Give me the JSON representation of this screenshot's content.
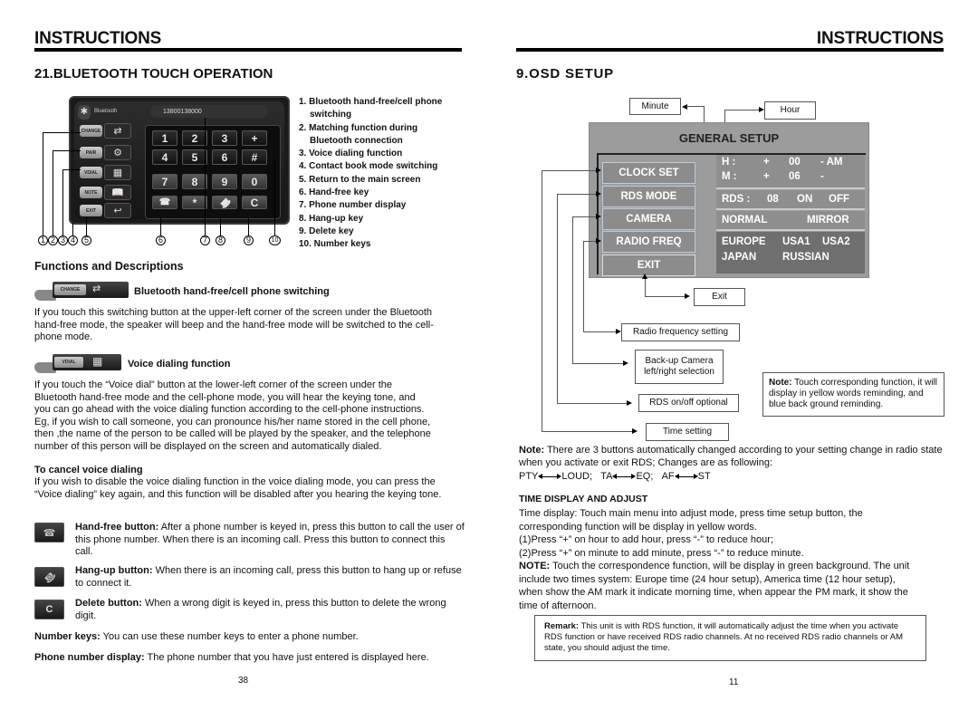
{
  "left_page": {
    "header": "INSTRUCTIONS",
    "section_title": "21.BLUETOOTH TOUCH OPERATION",
    "device_screen": {
      "brand_label": "Bluetooth",
      "phone_number": "13800138000",
      "side_buttons": [
        "CHANGE",
        "PAIR",
        "VDIAL",
        "NOTE",
        "EXIT"
      ],
      "keys": [
        "1",
        "2",
        "3",
        "+",
        "4",
        "5",
        "6",
        "#",
        "7",
        "8",
        "9",
        "0",
        "call",
        "*",
        "hangup",
        "C"
      ],
      "callouts": [
        "1",
        "2",
        "3",
        "4",
        "5",
        "6",
        "7",
        "8",
        "9",
        "10"
      ]
    },
    "legend": [
      "1. Bluetooth hand-free/cell phone switching",
      "2. Matching function during Bluetooth connection",
      "3. Voice dialing function",
      "4. Contact book mode switching",
      "5. Return to the main screen",
      "6. Hand-free key",
      "7. Phone number display",
      "8. Hang-up key",
      "9. Delete key",
      "10. Number keys"
    ],
    "functions_title": "Functions and Descriptions",
    "switching": {
      "button_label": "CHANGE",
      "title": "Bluetooth hand-free/cell phone switching",
      "text": "If you touch this switching button at the upper-left corner of the screen under the Bluetooth hand-free mode, the speaker will beep and the hand-free mode will be switched to the cell-phone mode."
    },
    "voice": {
      "button_label": "VDIAL",
      "title": "Voice dialing function",
      "text": "If you touch the “Voice dial” button at the lower-left corner of the screen under the Bluetooth hand-free mode and the cell-phone mode, you will hear the keying tone, and you can go ahead with the voice dialing function according to the cell-phone instructions. Eg, if you wish to call someone, you can pronounce his/her name stored in the cell phone, then ,the name of the person to be called will be played by the speaker, and the telephone number of this person will be displayed on the screen and automatically dialed.",
      "cancel_title": "To cancel voice dialing",
      "cancel_text": "If you wish to disable the voice dialing function in the voice dialing mode, you can press the “Voice dialing” key again, and this function will be disabled after you hearing the keying tone."
    },
    "buttons_desc": [
      {
        "icon": "handset-icon",
        "label": "Hand-free button:",
        "text": " After a phone number is keyed in, press this button to call the user of this phone number. When there is an incoming call. Press this button to connect this call."
      },
      {
        "icon": "hangup-icon",
        "label": "Hang-up button:",
        "text": " When there is an incoming call, press this button to hang up or refuse to connect it."
      },
      {
        "icon": "delete-c-icon",
        "glyph": "C",
        "label": "Delete button:",
        "text": " When a wrong digit is keyed in, press this button to delete the wrong digit."
      }
    ],
    "number_keys": {
      "label": "Number keys:",
      "text": " You can use these number keys to enter a phone number."
    },
    "phone_display": {
      "label": "Phone number display:",
      "text": " The phone number that you have just entered is displayed here."
    },
    "page_number": "38"
  },
  "right_page": {
    "header": "INSTRUCTIONS",
    "section_title": "9.OSD SETUP",
    "osd": {
      "title": "GENERAL SETUP",
      "menu": [
        "CLOCK SET",
        "RDS MODE",
        "CAMERA",
        "RADIO FREQ",
        "EXIT"
      ],
      "clock": {
        "h_label": "H :",
        "h_plus": "+",
        "h_value": "00",
        "h_minus": "- AM",
        "m_label": "M :",
        "m_plus": "+",
        "m_value": "06",
        "m_minus": "-"
      },
      "rds": {
        "label": "RDS :",
        "value": "08",
        "on": "ON",
        "off": "OFF"
      },
      "camera": {
        "normal": "NORMAL",
        "mirror": "MIRROR"
      },
      "radio": [
        "EUROPE",
        "USA1",
        "USA2",
        "JAPAN",
        "RUSSIAN"
      ]
    },
    "labels": {
      "minute": "Minute",
      "hour": "Hour",
      "exit": "Exit",
      "radio_freq": "Radio frequency setting",
      "camera": "Back-up Camera left/right selection",
      "rds": "RDS on/off optional",
      "time": "Time setting"
    },
    "note_box": {
      "label": "Note:",
      "text": " Touch corresponding function, it will display in yellow words reminding, and blue back ground reminding."
    },
    "note_rds": {
      "label": "Note:",
      "text": " There are 3 buttons automatically changed according to your setting change in radio state when you activate or exit RDS; Changes are as following:"
    },
    "swaps": [
      {
        "a": "PTY",
        "b": "LOUD;"
      },
      {
        "a": "TA",
        "b": "EQ;"
      },
      {
        "a": "AF",
        "b": "ST"
      }
    ],
    "time_title": "TIME DISPLAY AND ADJUST",
    "time_text": [
      "Time display: Touch main menu into adjust mode, press time setup button, the corresponding function will be display in yellow words.",
      "(1)Press “+” on hour to add hour, press “-” to reduce hour;",
      "(2)Press “+” on minute to add minute, press “-” to reduce minute."
    ],
    "time_note": {
      "label": "NOTE:",
      "text": " Touch the correspondence function, will be display in green background. The unit include two times system: Europe time (24 hour setup), America time (12 hour setup), when show the AM mark it indicate morning time, when appear the PM mark, it show the time of afternoon."
    },
    "remark": {
      "label": "Remark:",
      "text": " This unit is with RDS function, it will automatically adjust the time when you activate RDS function or have received RDS radio channels. At no received RDS radio channels or AM state, you should adjust the time."
    },
    "page_number": "11"
  }
}
